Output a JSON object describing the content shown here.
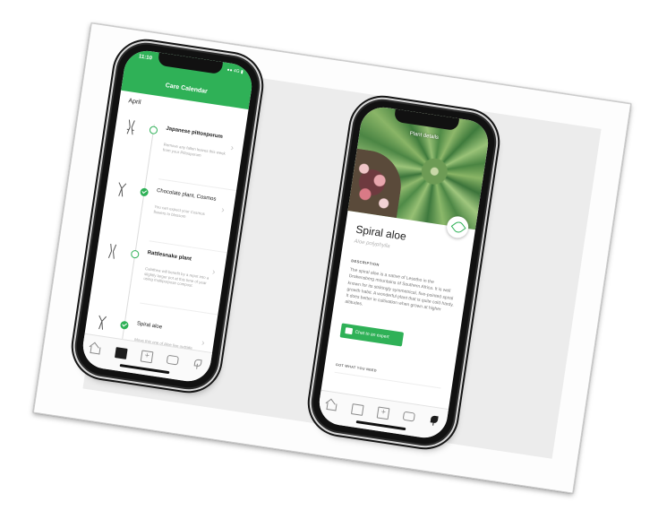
{
  "left_phone": {
    "status_time": "11:10",
    "status_right": "●● 4G ▮",
    "header_title": "Care Calendar",
    "month": "April",
    "tasks": [
      {
        "title": "Japanese pittosporum",
        "desc": "Remove any fallen leaves this week from your Pittosporum",
        "done": false
      },
      {
        "title": "Chocolate plant, Cosmos",
        "desc": "You can expect your Cosmos flowers to blossom",
        "done": true
      },
      {
        "title": "Rattlesnake plant",
        "desc": "Calathea will benefit by a repot into a slightly larger pot at this time of year using multipurpose compost.",
        "done": false
      },
      {
        "title": "Spiral aloe",
        "desc": "Move this one of Aloe live outside you can leave your Aloe outdoors",
        "done": true
      }
    ],
    "tabs": [
      "home-icon",
      "calendar-icon",
      "add-icon",
      "chat-icon",
      "plant-icon"
    ],
    "active_tab": "calendar-icon"
  },
  "right_phone": {
    "photo_title": "Plant details",
    "plant_name": "Spiral aloe",
    "plant_latin": "Aloe polyphylla",
    "section_label": "DESCRIPTION",
    "description": "The spiral aloe is a native of Lesotho in the Drakensberg mountains of Southern Africa. It is well known for its strikingly symmetrical, five-pointed spiral growth habit. A wonderful plant that is quite cold hardy. It does better in cultivation when grown at higher altitudes.",
    "chat_button": "Chat to an expert",
    "got_label": "GOT WHAT YOU NEED",
    "tabs": [
      "home-icon",
      "calendar-icon",
      "add-icon",
      "chat-icon",
      "plant-icon"
    ],
    "active_tab": "plant-icon"
  },
  "colors": {
    "accent": "#2fb157",
    "phone_frame": "#111111",
    "card_bg": "#ececec"
  }
}
